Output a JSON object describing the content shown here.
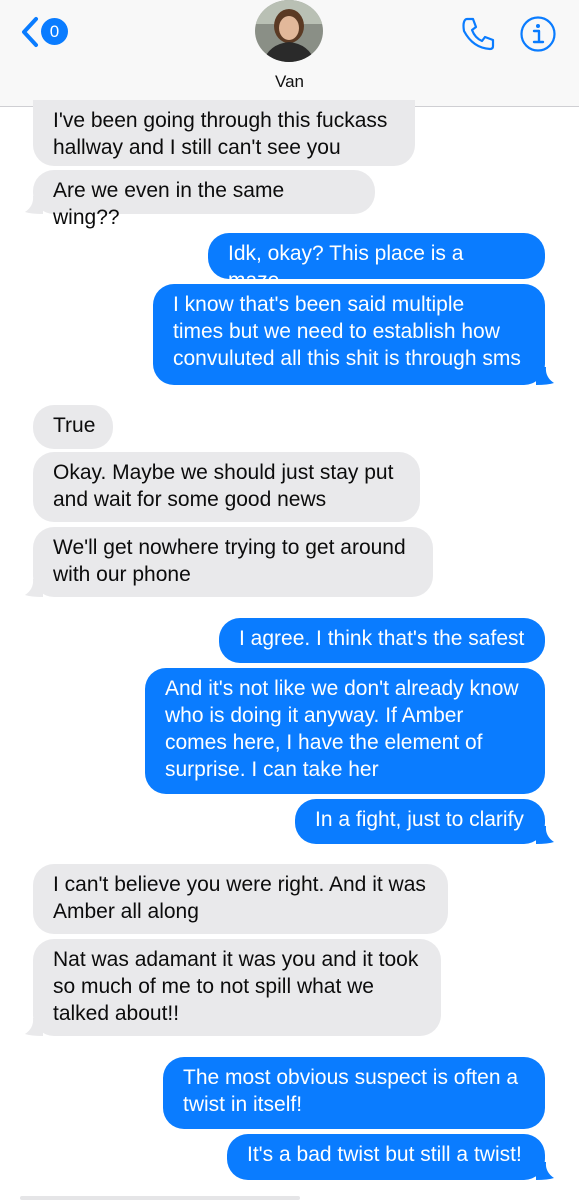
{
  "header": {
    "unread_count": "0",
    "contact_name": "Van",
    "accent_color": "#0a7cff",
    "icons": [
      "chevron-left-icon",
      "phone-icon",
      "info-icon"
    ]
  },
  "messages": [
    {
      "direction": "incoming",
      "text": "I've been going through this fuckass\nhallway and I still can't see you"
    },
    {
      "direction": "incoming",
      "text": "Are we even in the same wing??"
    },
    {
      "direction": "outgoing",
      "text": "Idk, okay? This place is a maze."
    },
    {
      "direction": "outgoing",
      "text": "I know that's been said multiple\ntimes but we need to establish how\nconvuluted all this shit is through sms"
    },
    {
      "direction": "incoming",
      "text": "True"
    },
    {
      "direction": "incoming",
      "text": "Okay. Maybe we should just stay put\nand wait for some good news"
    },
    {
      "direction": "incoming",
      "text": "We'll get nowhere trying to get around\nwith our phone"
    },
    {
      "direction": "outgoing",
      "text": "I agree. I think that's the safest"
    },
    {
      "direction": "outgoing",
      "text": "And it's not like we don't already know\nwho is doing it anyway. If Amber\ncomes here, I have the element of\nsurprise. I can take her"
    },
    {
      "direction": "outgoing",
      "text": "In a fight, just to clarify"
    },
    {
      "direction": "incoming",
      "text": "I can't believe you were right. And it was\nAmber all along"
    },
    {
      "direction": "incoming",
      "text": "Nat was adamant it was you and it took\nso much of me to not spill what we\ntalked about!!"
    },
    {
      "direction": "outgoing",
      "text": "The most obvious suspect is often a\ntwist in itself!"
    },
    {
      "direction": "outgoing",
      "text": "It's a bad twist but still a twist!"
    }
  ]
}
